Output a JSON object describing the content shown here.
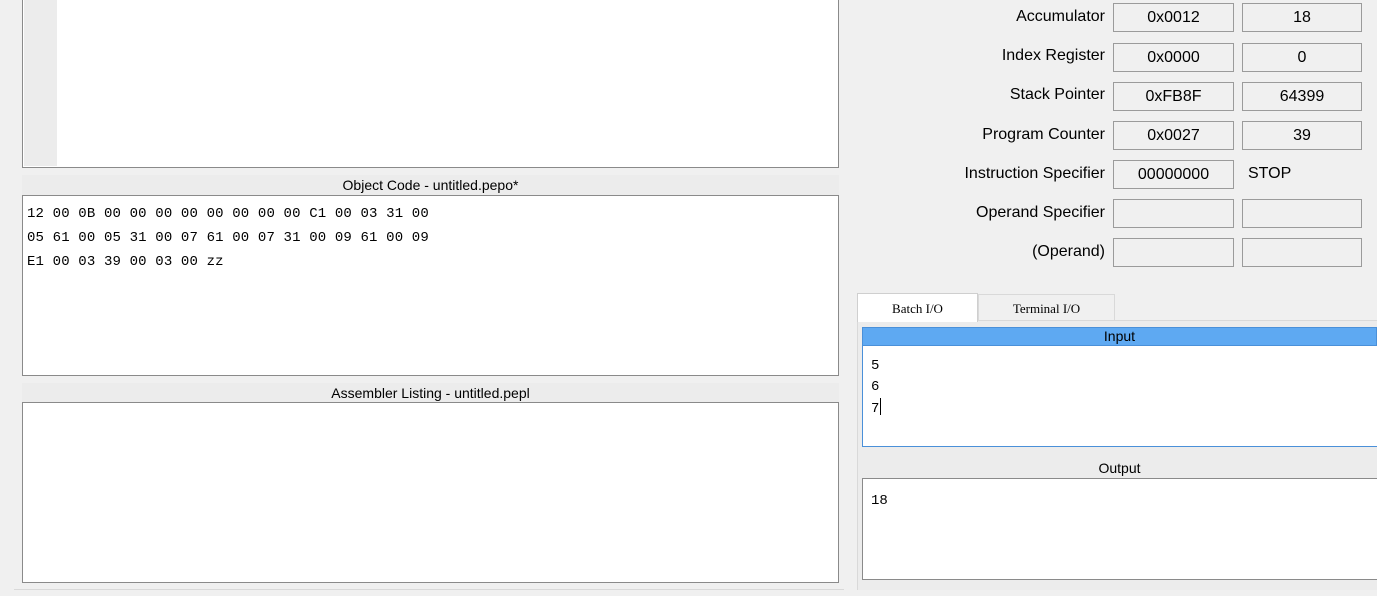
{
  "editor": {
    "object_code_title": "Object Code - untitled.pepo*",
    "object_code_lines": [
      "12 00 0B 00 00 00 00 00 00 00 00 C1 00 03 31 00",
      "05 61 00 05 31 00 07 61 00 07 31 00 09 61 00 09",
      "E1 00 03 39 00 03 00 zz"
    ],
    "assembler_listing_title": "Assembler Listing - untitled.pepl"
  },
  "cpu": {
    "accumulator": {
      "label": "Accumulator",
      "hex": "0x0012",
      "dec": "18"
    },
    "index_register": {
      "label": "Index Register",
      "hex": "0x0000",
      "dec": "0"
    },
    "stack_pointer": {
      "label": "Stack Pointer",
      "hex": "0xFB8F",
      "dec": "64399"
    },
    "program_counter": {
      "label": "Program Counter",
      "hex": "0x0027",
      "dec": "39"
    },
    "instruction_specifier": {
      "label": "Instruction Specifier",
      "bits": "00000000",
      "mnemonic": "STOP"
    },
    "operand_specifier": {
      "label": "Operand Specifier",
      "hex": "",
      "dec": ""
    },
    "operand": {
      "label": "(Operand)",
      "hex": "",
      "dec": ""
    }
  },
  "io": {
    "tabs": [
      "Batch I/O",
      "Terminal I/O"
    ],
    "active_tab": "Batch I/O",
    "input_title": "Input",
    "input_lines": [
      "5",
      "6",
      "7"
    ],
    "output_title": "Output",
    "output_lines": [
      "18"
    ]
  },
  "colors": {
    "window_bg": "#f0f0f0",
    "input_header": "#5ea9f2",
    "focus_border": "#4a90d9"
  }
}
